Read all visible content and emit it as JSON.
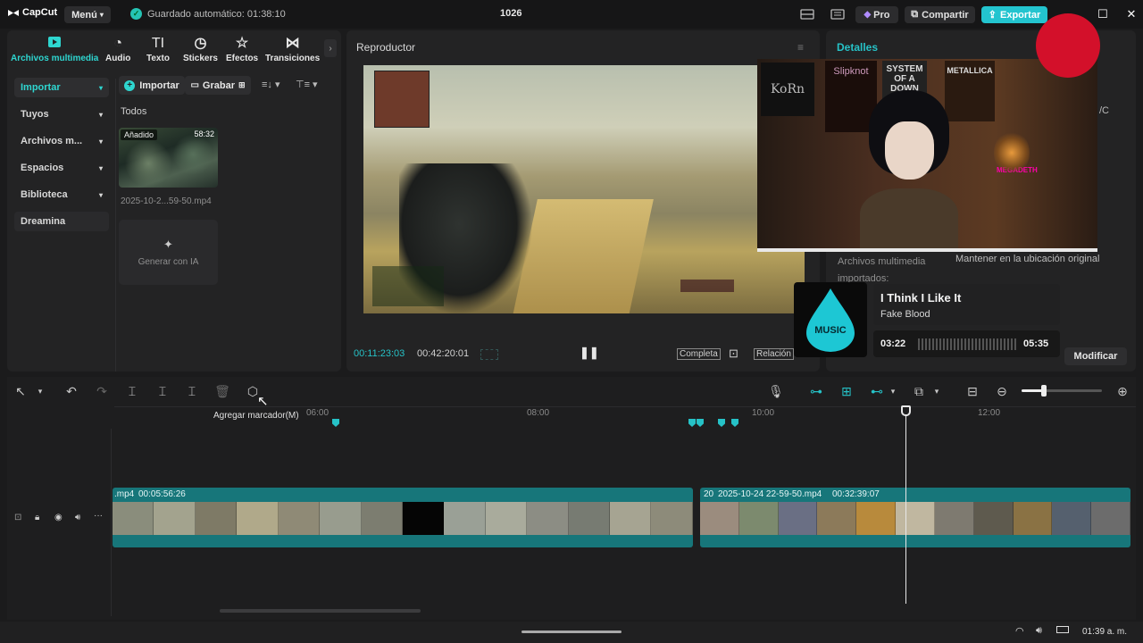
{
  "titlebar": {
    "app_name": "CapCut",
    "menu_label": "Menú",
    "autosave_text": "Guardado automático: 01:38:10",
    "project_name": "1026",
    "pro_label": "Pro",
    "share_label": "Compartir",
    "export_label": "Exportar"
  },
  "media_tools": [
    {
      "label": "Archivos multimedia",
      "icon": "media-icon",
      "active": true
    },
    {
      "label": "Audio",
      "icon": "audio-icon"
    },
    {
      "label": "Texto",
      "icon": "text-icon"
    },
    {
      "label": "Stickers",
      "icon": "sticker-icon"
    },
    {
      "label": "Efectos",
      "icon": "effects-icon"
    },
    {
      "label": "Transiciones",
      "icon": "transitions-icon"
    }
  ],
  "sidebar": {
    "items": [
      {
        "label": "Importar"
      },
      {
        "label": "Tuyos"
      },
      {
        "label": "Archivos m..."
      },
      {
        "label": "Espacios"
      },
      {
        "label": "Biblioteca"
      },
      {
        "label": "Dreamina"
      }
    ]
  },
  "media": {
    "import_label": "Importar",
    "record_label": "Grabar",
    "section_label": "Todos",
    "item": {
      "badge": "Añadido",
      "duration": "58:32",
      "filename": "2025-10-2...59-50.mp4"
    },
    "genai_label": "Generar con IA"
  },
  "player": {
    "title": "Reproductor",
    "current_time": "00:11:23:03",
    "total_time": "00:42:20:01",
    "full_label": "Completa",
    "ratio_label": "Relación"
  },
  "details": {
    "title": "Detalles",
    "row_label": "Archivos multimedia importados:",
    "row_value": "Mantener en la ubicación original",
    "modify_label": "Modificar",
    "partial_text": "/C",
    "partial_text2": "/C"
  },
  "music_overlay": {
    "art_text": "MUSIC",
    "song_title": "I Think I Like It",
    "artist": "Fake Blood",
    "elapsed": "03:22",
    "duration": "05:35"
  },
  "webcam_overlay": {
    "posters": [
      "KoRn",
      "Slipknot",
      "SYSTEM OF A DOWN",
      "METALLICA",
      "MEGADETH"
    ]
  },
  "timeline": {
    "tooltip": "Agregar marcador(M)",
    "ruler": [
      "06:00",
      "08:00",
      "10:00",
      "12:00"
    ],
    "clip1": {
      "name": ".mp4",
      "duration": "00:05:56:26"
    },
    "clip2": {
      "prefix": "20",
      "name": "2025-10-24 22-59-50.mp4",
      "duration": "00:32:39:07"
    }
  },
  "taskbar": {
    "time": "01:39 a. m."
  },
  "colors": {
    "accent": "#26c2c7",
    "export": "#23c4cf",
    "clip": "#17767a",
    "panel": "#232324",
    "background": "#1b1b1c"
  }
}
